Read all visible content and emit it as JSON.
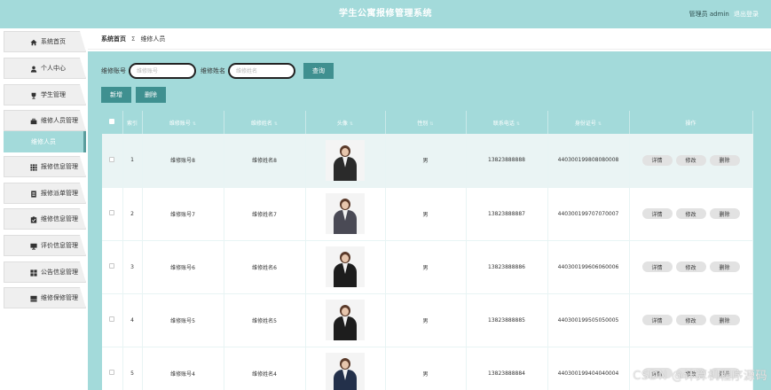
{
  "header": {
    "title": "学生公寓报修管理系统",
    "user_role": "管理员 admin",
    "logout": "退出登录"
  },
  "sidebar": {
    "items": [
      {
        "label": "系统首页",
        "icon": "home-icon"
      },
      {
        "label": "个人中心",
        "icon": "user-icon"
      },
      {
        "label": "学生管理",
        "icon": "trophy-icon"
      },
      {
        "label": "维修人员管理",
        "icon": "briefcase-icon"
      },
      {
        "label": "报修信息管理",
        "icon": "grid-icon"
      },
      {
        "label": "报修派单管理",
        "icon": "document-icon"
      },
      {
        "label": "维修信息管理",
        "icon": "checklist-icon"
      },
      {
        "label": "评价信息管理",
        "icon": "monitor-icon"
      },
      {
        "label": "公告信息管理",
        "icon": "apps-icon"
      },
      {
        "label": "维修保修管理",
        "icon": "inbox-icon"
      }
    ],
    "active_sub": "维修人员"
  },
  "breadcrumb": {
    "home": "系统首页",
    "separator": "Σ",
    "current": "维修人员"
  },
  "search": {
    "label_account": "维修账号",
    "placeholder_account": "维修账号",
    "label_name": "维修姓名",
    "placeholder_name": "维修姓名",
    "query_button": "查询"
  },
  "actions": {
    "add": "新增",
    "delete": "删除"
  },
  "table": {
    "columns": [
      "",
      "索引",
      "维修账号",
      "维修姓名",
      "头像",
      "性别",
      "联系电话",
      "身份证号",
      "操作"
    ],
    "sortable": [
      false,
      false,
      true,
      true,
      true,
      true,
      true,
      true,
      false
    ],
    "row_buttons": [
      "详情",
      "修改",
      "删除"
    ],
    "rows": [
      {
        "index": "1",
        "account": "维修账号8",
        "name": "维修姓名8",
        "gender": "男",
        "phone": "13823888888",
        "id_card": "440300199808080008"
      },
      {
        "index": "2",
        "account": "维修账号7",
        "name": "维修姓名7",
        "gender": "男",
        "phone": "13823888887",
        "id_card": "440300199707070007"
      },
      {
        "index": "3",
        "account": "维修账号6",
        "name": "维修姓名6",
        "gender": "男",
        "phone": "13823888886",
        "id_card": "440300199606060006"
      },
      {
        "index": "4",
        "account": "维修账号5",
        "name": "维修姓名5",
        "gender": "男",
        "phone": "13823888885",
        "id_card": "440300199505050005"
      },
      {
        "index": "5",
        "account": "维修账号4",
        "name": "维修姓名4",
        "gender": "男",
        "phone": "13823888884",
        "id_card": "440300199404040004"
      }
    ]
  },
  "watermark": "CSDN @计算机程序源码",
  "colors": {
    "header_bg": "#a3dada",
    "button_bg": "#3f9090",
    "sidebar_item_bg": "#efefef"
  }
}
